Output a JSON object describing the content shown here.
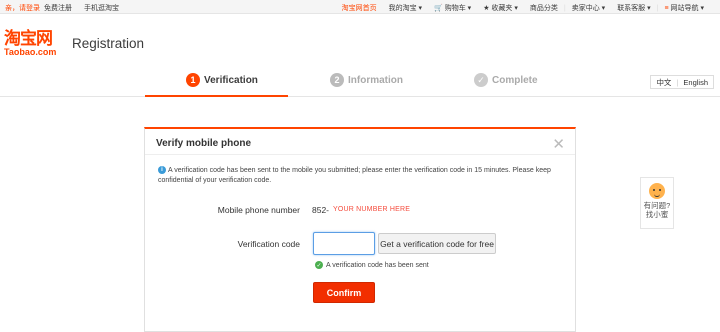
{
  "topbar": {
    "login": "亲，请登录",
    "register": "免费注册",
    "mobile": "手机逛淘宝",
    "home": "淘宝网首页",
    "my_taobao": "我的淘宝",
    "cart": "购物车",
    "favorites": "收藏夹",
    "categories": "商品分类",
    "seller_center": "卖家中心",
    "contact": "联系客服",
    "site_nav": "网站导航"
  },
  "header": {
    "logo_cn": "淘宝网",
    "logo_en": "Taobao.com",
    "title": "Registration"
  },
  "steps": [
    {
      "num": "1",
      "label": "Verification",
      "state": "active"
    },
    {
      "num": "2",
      "label": "Information",
      "state": "pending"
    },
    {
      "num": "",
      "label": "Complete",
      "state": "pending"
    }
  ],
  "language": {
    "zh": "中文",
    "en": "English"
  },
  "dialog": {
    "title": "Verify mobile phone",
    "notice": "A verification code has been sent to the mobile you submitted; please enter the verification code in 15 minutes. Please keep confidential of your verification code.",
    "phone_label": "Mobile phone number",
    "phone_prefix": "852-",
    "phone_value": "YOUR NUMBER HERE",
    "code_label": "Verification code",
    "code_value": "",
    "get_code_button": "Get a verification code for free",
    "sent_message": "A verification code has been sent",
    "confirm_button": "Confirm"
  },
  "help": {
    "line1": "有问题?",
    "line2": "找小蜜"
  },
  "colors": {
    "brand": "#ff4400",
    "confirm": "#f22e00",
    "info": "#3a9bd8",
    "success": "#4caf50"
  }
}
